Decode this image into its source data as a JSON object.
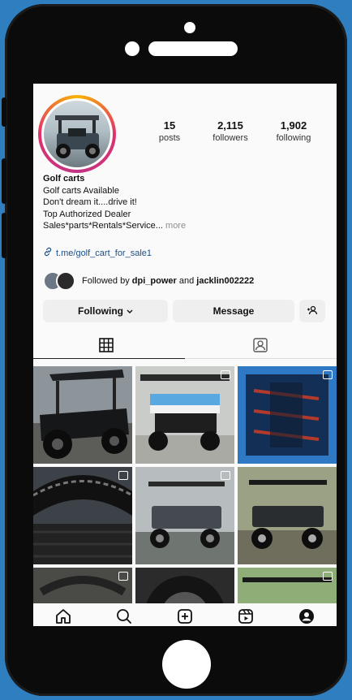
{
  "profile": {
    "posts_count": "15",
    "posts_label": "posts",
    "followers_count": "2,115",
    "followers_label": "followers",
    "following_count": "1,902",
    "following_label": "following",
    "name": "Golf carts",
    "bio_lines": [
      "Golf carts Available",
      "Don't dream it....drive it!",
      "Top Authorized Dealer"
    ],
    "bio_last": "Sales*parts*Rentals*Service...",
    "more_label": "more",
    "link": "t.me/golf_cart_for_sale1"
  },
  "followed_by": {
    "prefix": "Followed by",
    "user1": "dpi_power",
    "joiner": "and",
    "user2": "jacklin002222"
  },
  "actions": {
    "following_label": "Following",
    "message_label": "Message"
  },
  "tabs": [
    "grid-icon",
    "tagged-icon"
  ],
  "nav": [
    "home-icon",
    "search-icon",
    "create-icon",
    "reels-icon",
    "profile-icon"
  ],
  "colors": {
    "link": "#1a4e8a",
    "accent_ring": "#e1306c",
    "background": "#2f7fc0"
  }
}
